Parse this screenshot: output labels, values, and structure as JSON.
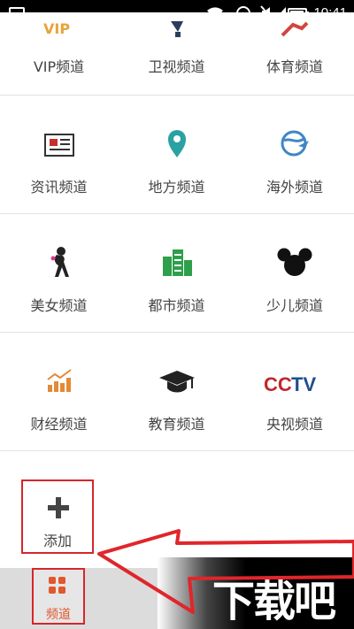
{
  "status_bar": {
    "time": "10:41",
    "icons": [
      "app-notification-icon",
      "wifi-icon",
      "data-sync-icon",
      "mute-icon",
      "signal-icon",
      "battery-icon"
    ]
  },
  "channels": [
    {
      "label": "VIP频道",
      "icon": "vip-icon",
      "color": "#e8a33a"
    },
    {
      "label": "卫视频道",
      "icon": "satellite-icon",
      "color": "#2b3d5c"
    },
    {
      "label": "体育频道",
      "icon": "sports-runner-icon",
      "color": "#d2453d"
    },
    {
      "label": "资讯频道",
      "icon": "news-icon",
      "color": "#c62f2f"
    },
    {
      "label": "地方频道",
      "icon": "location-pin-icon",
      "color": "#2aa1a2"
    },
    {
      "label": "海外频道",
      "icon": "globe-plane-icon",
      "color": "#3f86c7"
    },
    {
      "label": "美女频道",
      "icon": "lady-icon",
      "color": "#222222"
    },
    {
      "label": "都市频道",
      "icon": "buildings-icon",
      "color": "#2e9f4b"
    },
    {
      "label": "少儿频道",
      "icon": "mickey-icon",
      "color": "#111111"
    },
    {
      "label": "财经频道",
      "icon": "bar-chart-icon",
      "color": "#e48a35"
    },
    {
      "label": "教育频道",
      "icon": "graduation-cap-icon",
      "color": "#222222"
    },
    {
      "label": "央视频道",
      "icon": "cctv-logo-icon",
      "color": "#c1272d"
    }
  ],
  "add_button": {
    "label": "添加"
  },
  "bottom_tab": {
    "label": "频道"
  },
  "watermark": {
    "text": "下载吧"
  },
  "colors": {
    "highlight_red": "#d6262b",
    "accent_orange": "#e2572d",
    "divider": "#e2e2e2"
  }
}
